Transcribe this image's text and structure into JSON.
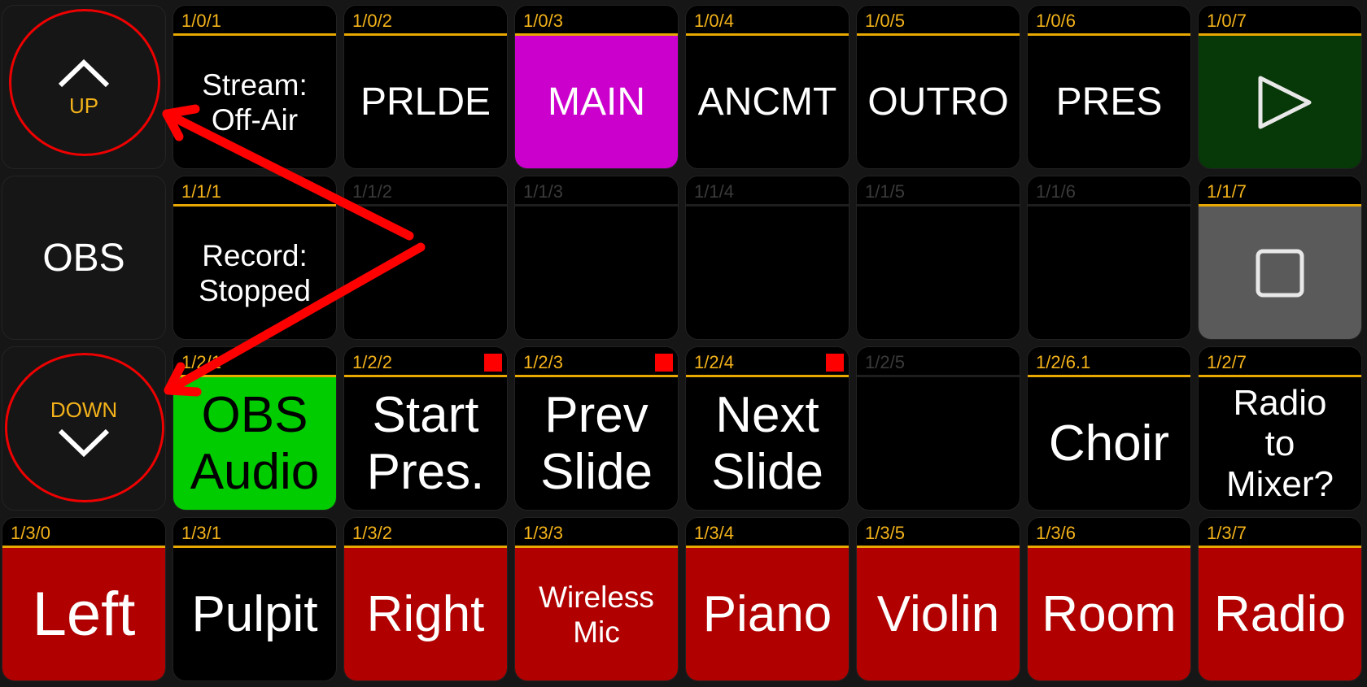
{
  "nav": {
    "up_label": "UP",
    "page_label": "OBS",
    "down_label": "DOWN"
  },
  "colors": {
    "header_accent": "#e8a800",
    "label_text": "#f3b21a",
    "magenta": "#cc00cc",
    "green": "#00cc00",
    "dark_green": "#073807",
    "gray": "#5a5a5a",
    "red": "#b00000",
    "indicator": "#ff0000",
    "annotation": "#ff0000"
  },
  "buttons": {
    "b001": {
      "id": "1/0/1",
      "text": [
        "Stream:",
        "Off-Air"
      ]
    },
    "b002": {
      "id": "1/0/2",
      "text": [
        "PRLDE"
      ]
    },
    "b003": {
      "id": "1/0/3",
      "text": [
        "MAIN"
      ]
    },
    "b004": {
      "id": "1/0/4",
      "text": [
        "ANCMT"
      ]
    },
    "b005": {
      "id": "1/0/5",
      "text": [
        "OUTRO"
      ]
    },
    "b006": {
      "id": "1/0/6",
      "text": [
        "PRES"
      ]
    },
    "b007": {
      "id": "1/0/7",
      "icon": "play-icon"
    },
    "b011": {
      "id": "1/1/1",
      "text": [
        "Record:",
        "Stopped"
      ]
    },
    "b012": {
      "id": "1/1/2"
    },
    "b013": {
      "id": "1/1/3"
    },
    "b014": {
      "id": "1/1/4"
    },
    "b015": {
      "id": "1/1/5"
    },
    "b016": {
      "id": "1/1/6"
    },
    "b017": {
      "id": "1/1/7",
      "icon": "stop-icon"
    },
    "b021": {
      "id": "1/2/1",
      "text": [
        "OBS",
        "Audio"
      ]
    },
    "b022": {
      "id": "1/2/2",
      "text": [
        "Start",
        "Pres."
      ]
    },
    "b023": {
      "id": "1/2/3",
      "text": [
        "Prev",
        "Slide"
      ]
    },
    "b024": {
      "id": "1/2/4",
      "text": [
        "Next",
        "Slide"
      ]
    },
    "b025": {
      "id": "1/2/5"
    },
    "b026": {
      "id": "1/2/6.1",
      "text": [
        "Choir"
      ]
    },
    "b027": {
      "id": "1/2/7",
      "text": [
        "Radio",
        "to",
        "Mixer?"
      ]
    },
    "b030": {
      "id": "1/3/0",
      "text": [
        "Left"
      ]
    },
    "b031": {
      "id": "1/3/1",
      "text": [
        "Pulpit"
      ]
    },
    "b032": {
      "id": "1/3/2",
      "text": [
        "Right"
      ]
    },
    "b033": {
      "id": "1/3/3",
      "text": [
        "Wireless",
        "Mic"
      ]
    },
    "b034": {
      "id": "1/3/4",
      "text": [
        "Piano"
      ]
    },
    "b035": {
      "id": "1/3/5",
      "text": [
        "Violin"
      ]
    },
    "b036": {
      "id": "1/3/6",
      "text": [
        "Room"
      ]
    },
    "b037": {
      "id": "1/3/7",
      "text": [
        "Radio"
      ]
    }
  }
}
